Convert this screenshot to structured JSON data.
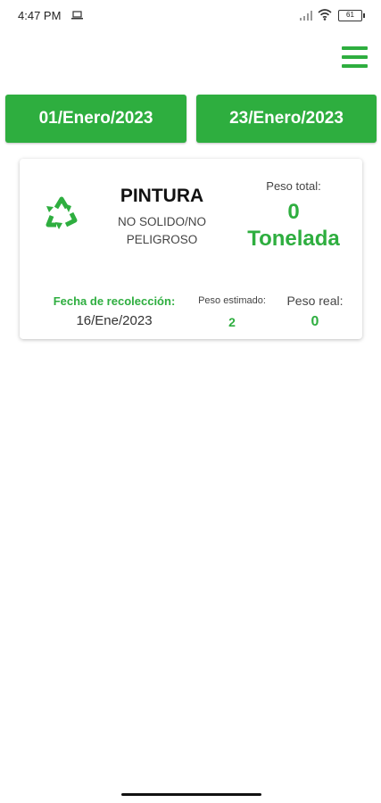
{
  "status_bar": {
    "time": "4:47 PM",
    "battery": "61",
    "icons": [
      "laptop-icon",
      "signal-icon",
      "wifi-icon",
      "battery-icon"
    ]
  },
  "header": {
    "menu_icon": "hamburger-menu-icon"
  },
  "date_range": {
    "start": "01/Enero/2023",
    "end": "23/Enero/2023"
  },
  "waste_card": {
    "icon": "recycle-icon",
    "name": "PINTURA",
    "type": "NO SOLIDO/NO PELIGROSO",
    "total_weight_label": "Peso total:",
    "total_weight_value": "0",
    "total_weight_unit": "Tonelada",
    "collection_date_label": "Fecha de recolección:",
    "collection_date": "16/Ene/2023",
    "estimated_weight_label": "Peso estimado:",
    "estimated_weight": "2",
    "real_weight_label": "Peso real:",
    "real_weight": "0"
  },
  "colors": {
    "accent": "#2eae3f",
    "background": "#ffffff",
    "text": "#222222"
  }
}
